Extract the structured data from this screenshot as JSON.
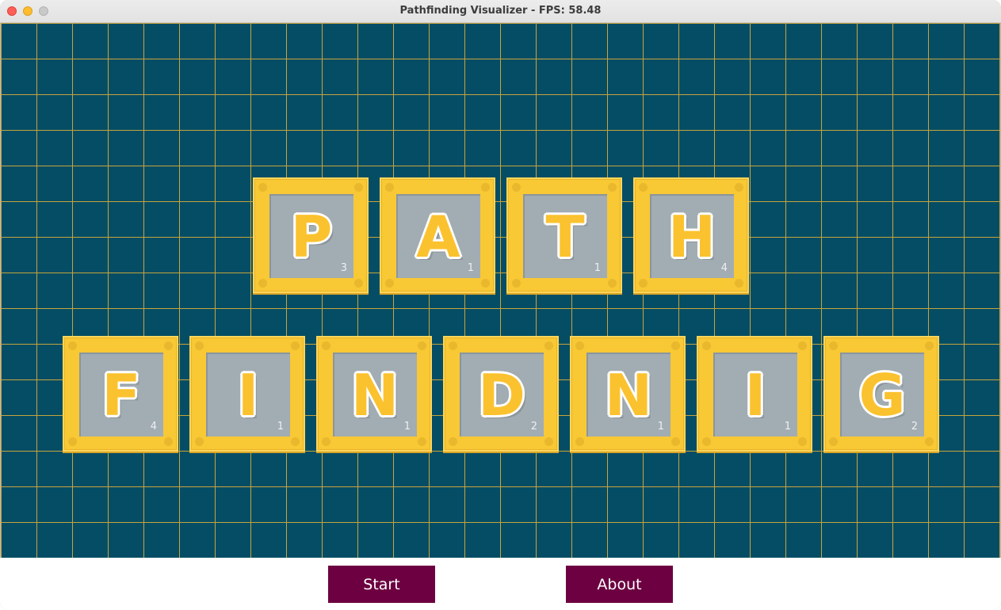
{
  "window": {
    "title": "Pathfinding Visualizer - FPS: 58.48"
  },
  "colors": {
    "grid_background": "#044d65",
    "grid_lines": "#c8a43c",
    "tile_frame": "#f8c835",
    "tile_inner": "#a2acb3",
    "button_background": "#6c0040",
    "button_text": "#ffffff"
  },
  "title_rows": [
    {
      "tiles": [
        {
          "letter": "P",
          "score": "3"
        },
        {
          "letter": "A",
          "score": "1"
        },
        {
          "letter": "T",
          "score": "1"
        },
        {
          "letter": "H",
          "score": "4"
        }
      ]
    },
    {
      "tiles": [
        {
          "letter": "F",
          "score": "4"
        },
        {
          "letter": "I",
          "score": "1"
        },
        {
          "letter": "N",
          "score": "1"
        },
        {
          "letter": "D",
          "score": "2"
        },
        {
          "letter": "N",
          "score": "1"
        },
        {
          "letter": "I",
          "score": "1"
        },
        {
          "letter": "G",
          "score": "2"
        }
      ]
    }
  ],
  "buttons": {
    "start_label": "Start",
    "about_label": "About"
  }
}
